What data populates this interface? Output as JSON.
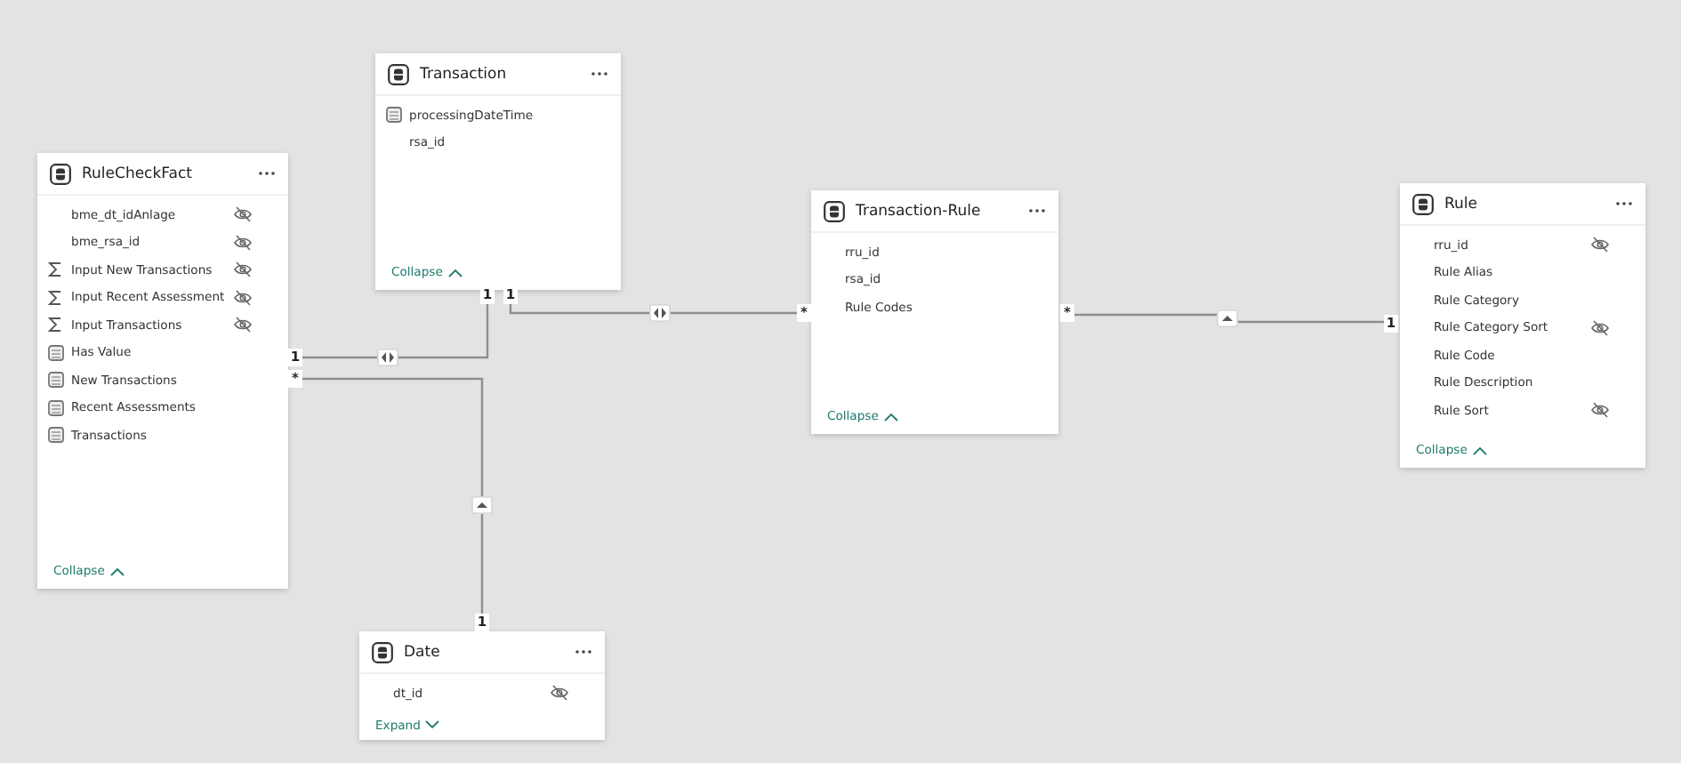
{
  "tables": [
    {
      "title": "RuleCheckFact",
      "fields": [
        {
          "name": "bme_dt_idAnlage",
          "kind": "column",
          "hidden": true
        },
        {
          "name": "bme_rsa_id",
          "kind": "column",
          "hidden": true
        },
        {
          "name": "Input New Transactions",
          "kind": "sum",
          "hidden": true
        },
        {
          "name": "Input Recent Assessment",
          "kind": "sum",
          "hidden": true
        },
        {
          "name": "Input Transactions",
          "kind": "sum",
          "hidden": true
        },
        {
          "name": "Has Value",
          "kind": "measure",
          "hidden": false
        },
        {
          "name": "New Transactions",
          "kind": "measure",
          "hidden": false
        },
        {
          "name": "Recent Assessments",
          "kind": "measure",
          "hidden": false
        },
        {
          "name": "Transactions",
          "kind": "measure",
          "hidden": false
        }
      ],
      "toggle": {
        "label": "Collapse",
        "expanded": true
      }
    },
    {
      "title": "Transaction",
      "fields": [
        {
          "name": "processingDateTime",
          "kind": "measure",
          "hidden": false
        },
        {
          "name": "rsa_id",
          "kind": "column",
          "hidden": false
        }
      ],
      "toggle": {
        "label": "Collapse",
        "expanded": true
      }
    },
    {
      "title": "Transaction-Rule",
      "fields": [
        {
          "name": "rru_id",
          "kind": "column",
          "hidden": false
        },
        {
          "name": "rsa_id",
          "kind": "column",
          "hidden": false
        },
        {
          "name": "Rule Codes",
          "kind": "column",
          "hidden": false
        }
      ],
      "toggle": {
        "label": "Collapse",
        "expanded": true
      }
    },
    {
      "title": "Rule",
      "fields": [
        {
          "name": "rru_id",
          "kind": "column",
          "hidden": true
        },
        {
          "name": "Rule Alias",
          "kind": "column",
          "hidden": false
        },
        {
          "name": "Rule Category",
          "kind": "column",
          "hidden": false
        },
        {
          "name": "Rule Category Sort",
          "kind": "column",
          "hidden": true
        },
        {
          "name": "Rule Code",
          "kind": "column",
          "hidden": false
        },
        {
          "name": "Rule Description",
          "kind": "column",
          "hidden": false
        },
        {
          "name": "Rule Sort",
          "kind": "column",
          "hidden": true
        }
      ],
      "toggle": {
        "label": "Collapse",
        "expanded": true
      }
    },
    {
      "title": "Date",
      "fields": [
        {
          "name": "dt_id",
          "kind": "column",
          "hidden": true
        }
      ],
      "toggle": {
        "label": "Expand",
        "expanded": false
      }
    }
  ],
  "relationships": [
    {
      "from_end": "1",
      "to_end": "1",
      "bidirectional": true
    },
    {
      "from_end": "1",
      "to_end": "*",
      "bidirectional": true
    },
    {
      "from_end": "*",
      "to_end": "1",
      "bidirectional": false
    },
    {
      "from_end": "*",
      "to_end": "1",
      "bidirectional": false
    }
  ]
}
